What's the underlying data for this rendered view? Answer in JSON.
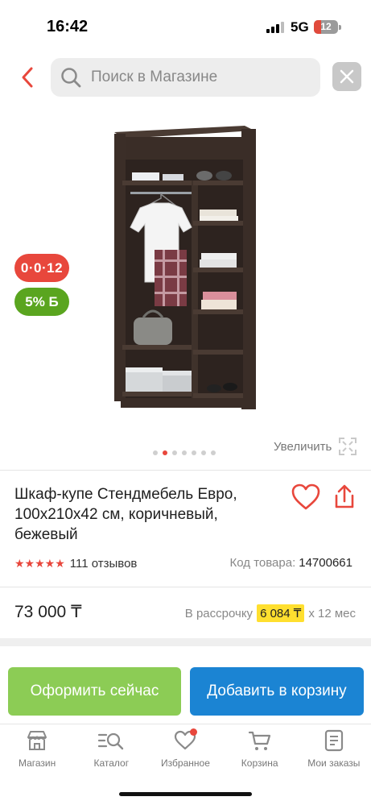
{
  "status_bar": {
    "time": "16:42",
    "network": "5G",
    "battery_level": "12"
  },
  "search": {
    "placeholder": "Поиск в Магазине",
    "value": ""
  },
  "header_icons": {
    "back": "chevron-left-icon",
    "search": "search-icon",
    "close": "close-icon"
  },
  "badges": {
    "credit": "0·0·12",
    "bonus": "5% Б"
  },
  "gallery": {
    "dots_total": 7,
    "active_dot": 2,
    "zoom_label": "Увеличить"
  },
  "product": {
    "title": "Шкаф-купе Стендмебель Евро, 100x210x42 см, коричневый, бежевый",
    "rating": 5,
    "reviews": "111 отзывов",
    "sku_label": "Код товара:",
    "sku_value": "14700661",
    "price": "73 000 ₸",
    "installment_prefix": "В рассрочку",
    "installment_amount": "6 084 ₸",
    "installment_suffix": "x 12 мес"
  },
  "actions": {
    "order_now": "Оформить сейчас",
    "add_to_cart": "Добавить в корзину"
  },
  "tabbar": {
    "items": [
      {
        "label": "Магазин",
        "icon": "store-icon"
      },
      {
        "label": "Каталог",
        "icon": "catalog-search-icon"
      },
      {
        "label": "Избранное",
        "icon": "heart-icon"
      },
      {
        "label": "Корзина",
        "icon": "cart-icon"
      },
      {
        "label": "Мои заказы",
        "icon": "orders-icon"
      }
    ]
  },
  "colors": {
    "accent_red": "#e8473c",
    "order_button": "#8ccc55",
    "cart_button": "#1b84d3",
    "installment_highlight": "#ffdf2f",
    "bonus_badge": "#5aa51f"
  }
}
